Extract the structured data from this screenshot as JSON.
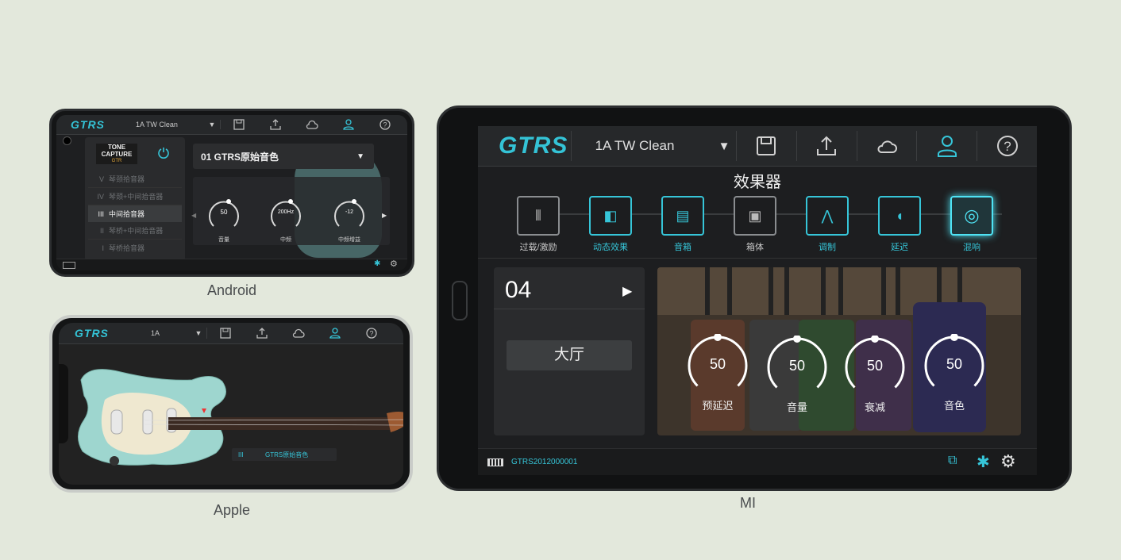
{
  "captions": {
    "android": "Android",
    "apple": "Apple",
    "mi": "MI"
  },
  "colors": {
    "accent": "#36c5d8",
    "active_glow": "#4fe3f4",
    "background": "#e3e8dc"
  },
  "android": {
    "logo": "GTRS",
    "preset": "1A TW Clean",
    "dropdown_icon": "caret-down-icon",
    "toolbar_icons": [
      "save-icon",
      "upload-icon",
      "cloud-icon",
      "user-icon",
      "help-icon"
    ],
    "tone_capture": {
      "line1": "TONE",
      "line2": "CAPTURE",
      "line3": "GTR"
    },
    "pickups": [
      {
        "roman": "V",
        "label": "琴颈拾音器",
        "selected": false
      },
      {
        "roman": "IV",
        "label": "琴颈+中间拾音器",
        "selected": false
      },
      {
        "roman": "III",
        "label": "中间拾音器",
        "selected": true
      },
      {
        "roman": "II",
        "label": "琴桥+中间拾音器",
        "selected": false
      },
      {
        "roman": "I",
        "label": "琴桥拾音器",
        "selected": false
      }
    ],
    "tone_preset": "01 GTRS原始音色",
    "knobs": [
      {
        "value": "50",
        "label": "音量"
      },
      {
        "value": "200Hz",
        "label": "中频"
      },
      {
        "value": "-12",
        "label": "中频增益"
      }
    ]
  },
  "apple": {
    "logo": "GTRS",
    "preset": "1A",
    "pickup": {
      "roman": "III",
      "label": "GTRS原始音色"
    }
  },
  "mi": {
    "logo": "GTRS",
    "preset": "1A TW Clean",
    "section_title": "效果器",
    "effects": [
      {
        "label": "过载/激励",
        "state": "off",
        "icon": "overdrive-icon"
      },
      {
        "label": "动态效果",
        "state": "on",
        "icon": "dynamics-icon"
      },
      {
        "label": "音箱",
        "state": "on",
        "icon": "amp-icon"
      },
      {
        "label": "箱体",
        "state": "off",
        "icon": "cabinet-icon"
      },
      {
        "label": "调制",
        "state": "on",
        "icon": "modulation-icon"
      },
      {
        "label": "延迟",
        "state": "on",
        "icon": "delay-icon"
      },
      {
        "label": "混响",
        "state": "active",
        "icon": "reverb-icon"
      }
    ],
    "preset_number": "04",
    "preset_type": "大厅",
    "knobs": [
      {
        "value": "50",
        "label": "预延迟",
        "level": 0.5
      },
      {
        "value": "50",
        "label": "音量",
        "level": 0.5
      },
      {
        "value": "50",
        "label": "衰减",
        "level": 0.5
      },
      {
        "value": "50",
        "label": "音色",
        "level": 0.5
      }
    ],
    "device_id": "GTRS2012000001"
  }
}
